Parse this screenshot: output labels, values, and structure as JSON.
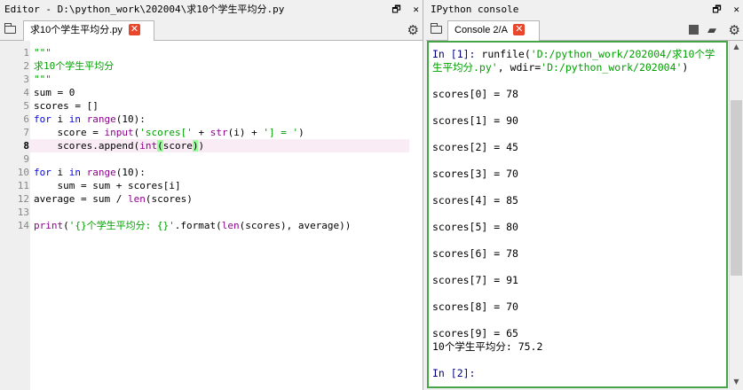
{
  "editor": {
    "title": "Editor - D:\\python_work\\202004\\求10个学生平均分.py",
    "tab_label": "求10个学生平均分.py",
    "lines": [
      {
        "n": "1",
        "segs": [
          {
            "t": "\"\"\"",
            "c": "str"
          }
        ]
      },
      {
        "n": "2",
        "segs": [
          {
            "t": "求10个学生平均分",
            "c": "str"
          }
        ]
      },
      {
        "n": "3",
        "segs": [
          {
            "t": "\"\"\"",
            "c": "str"
          }
        ]
      },
      {
        "n": "4",
        "segs": [
          {
            "t": "sum = 0",
            "c": ""
          }
        ]
      },
      {
        "n": "5",
        "segs": [
          {
            "t": "scores = []",
            "c": ""
          }
        ]
      },
      {
        "n": "6",
        "segs": [
          {
            "t": "for",
            "c": "kw"
          },
          {
            "t": " i ",
            "c": ""
          },
          {
            "t": "in",
            "c": "kw"
          },
          {
            "t": " ",
            "c": ""
          },
          {
            "t": "range",
            "c": "bi"
          },
          {
            "t": "(10):",
            "c": ""
          }
        ]
      },
      {
        "n": "7",
        "segs": [
          {
            "t": "    score = ",
            "c": ""
          },
          {
            "t": "input",
            "c": "bi"
          },
          {
            "t": "(",
            "c": ""
          },
          {
            "t": "'scores['",
            "c": "str"
          },
          {
            "t": " + ",
            "c": ""
          },
          {
            "t": "str",
            "c": "bi"
          },
          {
            "t": "(i) + ",
            "c": ""
          },
          {
            "t": "'] = '",
            "c": "str"
          },
          {
            "t": ")",
            "c": ""
          }
        ]
      },
      {
        "n": "8",
        "segs": [
          {
            "t": "    scores.append(",
            "c": ""
          },
          {
            "t": "int",
            "c": "bi"
          },
          {
            "t": "(",
            "c": "pm"
          },
          {
            "t": "score",
            "c": ""
          },
          {
            "t": ")",
            "c": "pm"
          },
          {
            "t": ")",
            "c": ""
          }
        ],
        "current": true
      },
      {
        "n": "9",
        "segs": []
      },
      {
        "n": "10",
        "segs": [
          {
            "t": "for",
            "c": "kw"
          },
          {
            "t": " i ",
            "c": ""
          },
          {
            "t": "in",
            "c": "kw"
          },
          {
            "t": " ",
            "c": ""
          },
          {
            "t": "range",
            "c": "bi"
          },
          {
            "t": "(10):",
            "c": ""
          }
        ]
      },
      {
        "n": "11",
        "segs": [
          {
            "t": "    sum = sum + scores[i]",
            "c": ""
          }
        ]
      },
      {
        "n": "12",
        "segs": [
          {
            "t": "average = sum / ",
            "c": ""
          },
          {
            "t": "len",
            "c": "bi"
          },
          {
            "t": "(scores)",
            "c": ""
          }
        ]
      },
      {
        "n": "13",
        "segs": []
      },
      {
        "n": "14",
        "segs": [
          {
            "t": "print",
            "c": "bi"
          },
          {
            "t": "(",
            "c": ""
          },
          {
            "t": "'{}个学生平均分: {}'",
            "c": "str"
          },
          {
            "t": ".format(",
            "c": ""
          },
          {
            "t": "len",
            "c": "bi"
          },
          {
            "t": "(scores), average))",
            "c": ""
          }
        ]
      }
    ]
  },
  "console": {
    "title": "IPython console",
    "tab_label": "Console 2/A",
    "lines": [
      {
        "segs": [
          {
            "t": "In [1]: ",
            "c": "prompt"
          },
          {
            "t": "runfile(",
            "c": ""
          },
          {
            "t": "'D:/python_work/202004/求10个学",
            "c": "cstr"
          }
        ]
      },
      {
        "segs": [
          {
            "t": "生平均分.py'",
            "c": "cstr"
          },
          {
            "t": ", wdir=",
            "c": ""
          },
          {
            "t": "'D:/python_work/202004'",
            "c": "cstr"
          },
          {
            "t": ")",
            "c": ""
          }
        ]
      },
      {
        "segs": []
      },
      {
        "segs": [
          {
            "t": "scores[0] = 78",
            "c": ""
          }
        ]
      },
      {
        "segs": []
      },
      {
        "segs": [
          {
            "t": "scores[1] = 90",
            "c": ""
          }
        ]
      },
      {
        "segs": []
      },
      {
        "segs": [
          {
            "t": "scores[2] = 45",
            "c": ""
          }
        ]
      },
      {
        "segs": []
      },
      {
        "segs": [
          {
            "t": "scores[3] = 70",
            "c": ""
          }
        ]
      },
      {
        "segs": []
      },
      {
        "segs": [
          {
            "t": "scores[4] = 85",
            "c": ""
          }
        ]
      },
      {
        "segs": []
      },
      {
        "segs": [
          {
            "t": "scores[5] = 80",
            "c": ""
          }
        ]
      },
      {
        "segs": []
      },
      {
        "segs": [
          {
            "t": "scores[6] = 78",
            "c": ""
          }
        ]
      },
      {
        "segs": []
      },
      {
        "segs": [
          {
            "t": "scores[7] = 91",
            "c": ""
          }
        ]
      },
      {
        "segs": []
      },
      {
        "segs": [
          {
            "t": "scores[8] = 70",
            "c": ""
          }
        ]
      },
      {
        "segs": []
      },
      {
        "segs": [
          {
            "t": "scores[9] = 65",
            "c": ""
          }
        ]
      },
      {
        "segs": [
          {
            "t": "10个学生平均分: 75.2",
            "c": ""
          }
        ]
      },
      {
        "segs": []
      },
      {
        "segs": [
          {
            "t": "In [2]:",
            "c": "prompt"
          }
        ]
      }
    ]
  },
  "icons": {
    "restore": "🗗",
    "close": "✕",
    "tab_close": "✕",
    "gear": "⚙",
    "scroll_up": "▲",
    "scroll_down": "▼"
  }
}
